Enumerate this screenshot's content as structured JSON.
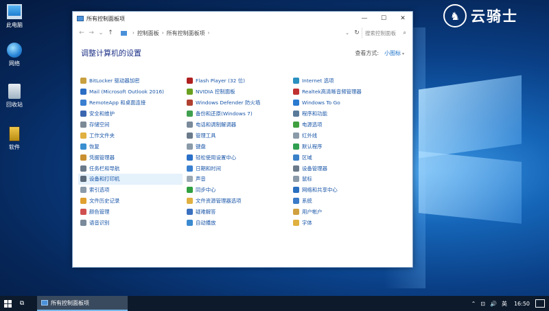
{
  "desktop": {
    "icons": [
      {
        "label": "此电脑",
        "icon": "computer-icon"
      },
      {
        "label": "网络",
        "icon": "network-icon"
      },
      {
        "label": "回收站",
        "icon": "recycle-bin-icon"
      },
      {
        "label": "软件",
        "icon": "folder-icon"
      }
    ],
    "watermark": "云骑士"
  },
  "window": {
    "title": "所有控制面板项",
    "controls": {
      "minimize": "—",
      "maximize": "☐",
      "close": "✕"
    },
    "nav": {
      "back": "←",
      "forward": "→",
      "recent": "⌄",
      "up": "↑",
      "breadcrumb": [
        "控制面板",
        "所有控制面板项"
      ],
      "refresh": "↻",
      "search_placeholder": "搜索控制面板"
    },
    "page_title": "调整计算机的设置",
    "view_by_label": "查看方式:",
    "view_by_value": "小图标",
    "columns": [
      [
        {
          "label": "BitLocker 驱动器加密",
          "color": "#c8a040"
        },
        {
          "label": "Mail (Microsoft Outlook 2016)",
          "color": "#2a6dc4"
        },
        {
          "label": "RemoteApp 和桌面连接",
          "color": "#3a7fd0"
        },
        {
          "label": "安全和维护",
          "color": "#3a66b0"
        },
        {
          "label": "存储空间",
          "color": "#7c8a96"
        },
        {
          "label": "工作文件夹",
          "color": "#e0b040"
        },
        {
          "label": "恢复",
          "color": "#3a8fd0"
        },
        {
          "label": "凭据管理器",
          "color": "#c89030"
        },
        {
          "label": "任务栏和导航",
          "color": "#6a7a8a"
        },
        {
          "label": "设备和打印机",
          "color": "#5a6a7a"
        },
        {
          "label": "索引选项",
          "color": "#8a9aa8"
        },
        {
          "label": "文件历史记录",
          "color": "#e0a030"
        },
        {
          "label": "颜色管理",
          "color": "#d05050"
        },
        {
          "label": "语音识别",
          "color": "#7a8a9a"
        }
      ],
      [
        {
          "label": "Flash Player (32 位)",
          "color": "#b02020"
        },
        {
          "label": "NVIDIA 控制面板",
          "color": "#6aa020"
        },
        {
          "label": "Windows Defender 防火墙",
          "color": "#b04030"
        },
        {
          "label": "备份和还原(Windows 7)",
          "color": "#40a050"
        },
        {
          "label": "电话和调制解调器",
          "color": "#7a8a9a"
        },
        {
          "label": "管理工具",
          "color": "#6a7a8a"
        },
        {
          "label": "键盘",
          "color": "#8a9aa8"
        },
        {
          "label": "轻松使用设置中心",
          "color": "#2a70c8"
        },
        {
          "label": "日期和时间",
          "color": "#3a80d0"
        },
        {
          "label": "声音",
          "color": "#9aa8b4"
        },
        {
          "label": "同步中心",
          "color": "#30a040"
        },
        {
          "label": "文件资源管理器选项",
          "color": "#e0b040"
        },
        {
          "label": "疑难解答",
          "color": "#3a70c0"
        },
        {
          "label": "自动播放",
          "color": "#3a8ad0"
        }
      ],
      [
        {
          "label": "Internet 选项",
          "color": "#2a90c0"
        },
        {
          "label": "Realtek高清晰音频管理器",
          "color": "#c03030"
        },
        {
          "label": "Windows To Go",
          "color": "#2a7ad0"
        },
        {
          "label": "程序和功能",
          "color": "#5a7a9a"
        },
        {
          "label": "电源选项",
          "color": "#40a040"
        },
        {
          "label": "红外线",
          "color": "#8a9aa8"
        },
        {
          "label": "默认程序",
          "color": "#30a050"
        },
        {
          "label": "区域",
          "color": "#3a80c8"
        },
        {
          "label": "设备管理器",
          "color": "#6a7a8a"
        },
        {
          "label": "鼠标",
          "color": "#8a9aa8"
        },
        {
          "label": "网络和共享中心",
          "color": "#2a70c0"
        },
        {
          "label": "系统",
          "color": "#3a7ac8"
        },
        {
          "label": "用户帐户",
          "color": "#d0a040"
        },
        {
          "label": "字体",
          "color": "#e0b040"
        }
      ]
    ]
  },
  "taskbar": {
    "app_label": "所有控制面板项",
    "tray": {
      "up": "⌃",
      "network": "⊡",
      "volume": "🔊",
      "ime": "英",
      "time": "16:50"
    }
  }
}
